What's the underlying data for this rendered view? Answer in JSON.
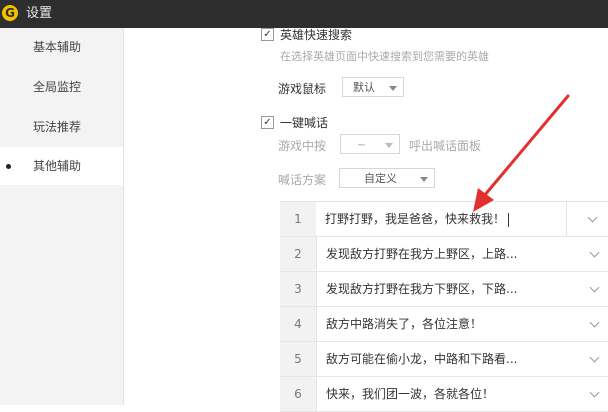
{
  "titlebar": {
    "logo_glyph": "G",
    "title": "设置"
  },
  "sidebar": {
    "items": [
      {
        "label": "基本辅助",
        "active": false
      },
      {
        "label": "全局监控",
        "active": false
      },
      {
        "label": "玩法推荐",
        "active": false
      },
      {
        "label": "其他辅助",
        "active": true
      }
    ]
  },
  "hero_search": {
    "checked": true,
    "check_glyph": "✓",
    "label": "英雄快速搜索",
    "description": "在选择英雄页面中快速搜索到您需要的英雄"
  },
  "game_mouse": {
    "label": "游戏鼠标",
    "value": "默认"
  },
  "quick_chat": {
    "checked": true,
    "check_glyph": "✓",
    "label": "一键喊话",
    "hotkey_label": "游戏中按",
    "hotkey_value": "~",
    "hotkey_suffix": "呼出喊话面板",
    "scheme_label": "喊话方案",
    "scheme_value": "自定义"
  },
  "phrases": [
    {
      "num": "1",
      "text": "打野打野，我是爸爸，快来救我！"
    },
    {
      "num": "2",
      "text": "发现敌方打野在我方上野区，上路..."
    },
    {
      "num": "3",
      "text": "发现敌方打野在我方下野区，下路..."
    },
    {
      "num": "4",
      "text": "敌方中路消失了，各位注意！"
    },
    {
      "num": "5",
      "text": "敌方可能在偷小龙，中路和下路看..."
    },
    {
      "num": "6",
      "text": "快来，我们团一波，各就各位！"
    }
  ],
  "colors": {
    "annotation_arrow": "#e23030",
    "titlebar": "#2e2e2e",
    "logo": "#f2c200"
  }
}
